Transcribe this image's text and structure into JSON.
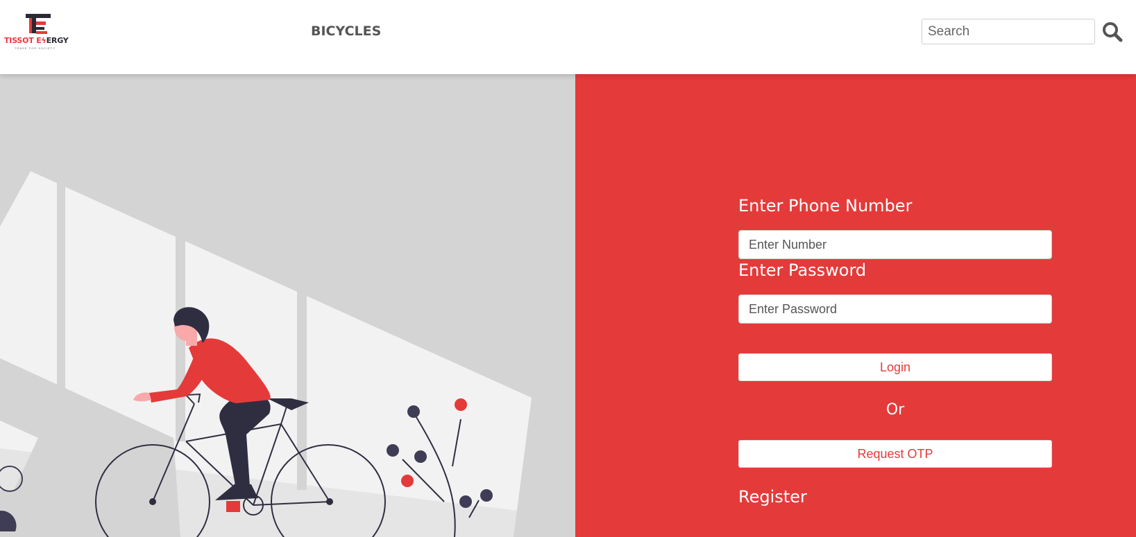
{
  "header": {
    "logo": {
      "text_part1": "TISSOT E",
      "text_part2": "ERGY",
      "tagline": "TRADE FOR SOCIETY"
    },
    "nav": {
      "bicycles_label": "BICYCLES"
    },
    "search": {
      "placeholder": "Search",
      "icon": "search-icon"
    }
  },
  "hero": {
    "illustration": "person-riding-bicycle"
  },
  "login_form": {
    "phone_label": "Enter Phone Number",
    "phone_placeholder": "Enter Number",
    "password_label": "Enter Password",
    "password_placeholder": "Enter Password",
    "login_button": "Login",
    "or_text": "Or",
    "otp_button": "Request OTP",
    "register_link": "Register"
  },
  "colors": {
    "accent": "#e53a3a",
    "dark": "#2f2e41",
    "panel_grey": "#d4d4d4",
    "panel_light": "#f2f2f2"
  }
}
